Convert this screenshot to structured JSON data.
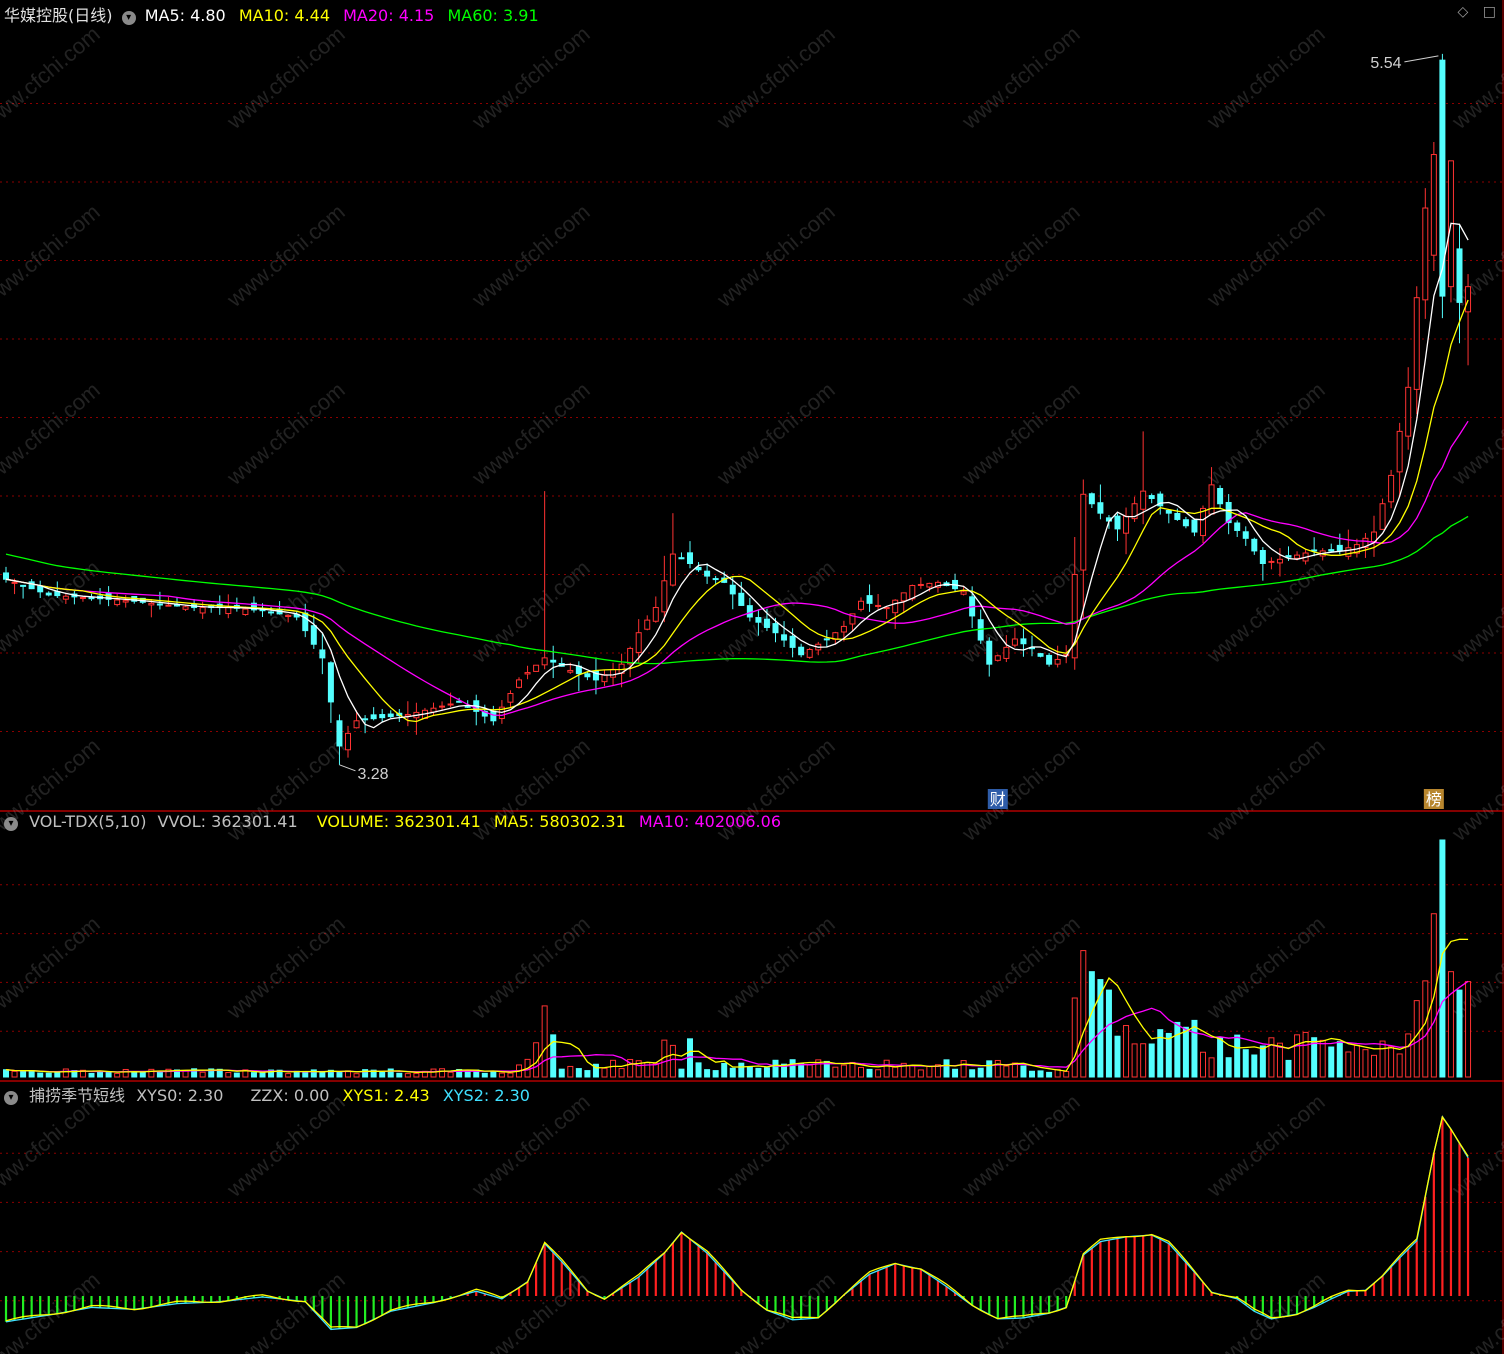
{
  "colors": {
    "up": "#FF3232",
    "down": "#54FFFF",
    "ma5": "#FFFFFF",
    "ma10": "#FFFF00",
    "ma20": "#FF00FF",
    "ma60": "#00FF00",
    "grid": "#8B0000",
    "divider": "#B00000",
    "text": "#C0C0C0",
    "xys_pos": "#FF2020",
    "xys_neg": "#22EE22"
  },
  "main_panel": {
    "title": "华媒控股(日线)",
    "ma_labels": [
      {
        "label": "MA5: 4.80",
        "color": "#FFFFFF"
      },
      {
        "label": "MA10: 4.44",
        "color": "#FFFF00"
      },
      {
        "label": "MA20: 4.15",
        "color": "#FF00FF"
      },
      {
        "label": "MA60: 3.91",
        "color": "#00FF00"
      }
    ],
    "high_label": "5.54",
    "low_label": "3.28",
    "markers": [
      {
        "text": "财",
        "index": 116,
        "bg": "#2E5CA8"
      },
      {
        "text": "榜",
        "index": 167,
        "bg": "#B8862E"
      }
    ]
  },
  "volume_panel": {
    "labels": [
      {
        "label": "VOL-TDX(5,10)",
        "color": "#C0C0C0"
      },
      {
        "label": "VVOL: 362301.41",
        "color": "#C0C0C0"
      },
      {
        "label": "VOLUME: 362301.41",
        "color": "#FFFF00"
      },
      {
        "label": "MA5: 580302.31",
        "color": "#FFFF00"
      },
      {
        "label": "MA10: 402006.06",
        "color": "#FF00FF"
      }
    ]
  },
  "indicator_panel": {
    "labels": [
      {
        "label": "捕捞季节短线",
        "color": "#C0C0C0"
      },
      {
        "label": "XYS0: 2.30",
        "color": "#C0C0C0"
      },
      {
        "label": "ZZX: 0.00",
        "color": "#C0C0C0"
      },
      {
        "label": "XYS1: 2.43",
        "color": "#FFFF00"
      },
      {
        "label": "XYS2: 2.30",
        "color": "#40E0FF"
      }
    ]
  },
  "watermark": "www.cfchi.com",
  "chart_data": {
    "type": "candlestick",
    "title": "华媒控股(日线)",
    "price_range": [
      3.2,
      5.6
    ],
    "days": 172,
    "anchors": [
      [
        0,
        3.87
      ],
      [
        5,
        3.82
      ],
      [
        10,
        3.81
      ],
      [
        15,
        3.8
      ],
      [
        18,
        3.79
      ],
      [
        22,
        3.78
      ],
      [
        26,
        3.78
      ],
      [
        30,
        3.77
      ],
      [
        34,
        3.75
      ],
      [
        37,
        3.62
      ],
      [
        39,
        3.34
      ],
      [
        41,
        3.42
      ],
      [
        44,
        3.43
      ],
      [
        47,
        3.44
      ],
      [
        50,
        3.46
      ],
      [
        53,
        3.48
      ],
      [
        55,
        3.45
      ],
      [
        57,
        3.42
      ],
      [
        60,
        3.55
      ],
      [
        63,
        3.62
      ],
      [
        66,
        3.58
      ],
      [
        69,
        3.55
      ],
      [
        72,
        3.6
      ],
      [
        74,
        3.7
      ],
      [
        76,
        3.78
      ],
      [
        78,
        3.95
      ],
      [
        80,
        3.92
      ],
      [
        82,
        3.88
      ],
      [
        84,
        3.86
      ],
      [
        87,
        3.75
      ],
      [
        90,
        3.7
      ],
      [
        93,
        3.63
      ],
      [
        96,
        3.68
      ],
      [
        98,
        3.72
      ],
      [
        100,
        3.8
      ],
      [
        103,
        3.78
      ],
      [
        106,
        3.85
      ],
      [
        109,
        3.86
      ],
      [
        112,
        3.83
      ],
      [
        115,
        3.6
      ],
      [
        118,
        3.68
      ],
      [
        120,
        3.65
      ],
      [
        122,
        3.6
      ],
      [
        124,
        3.63
      ],
      [
        126,
        4.14
      ],
      [
        128,
        4.08
      ],
      [
        130,
        4.03
      ],
      [
        133,
        4.15
      ],
      [
        136,
        4.08
      ],
      [
        139,
        4.02
      ],
      [
        141,
        4.17
      ],
      [
        143,
        4.05
      ],
      [
        145,
        4.0
      ],
      [
        147,
        3.92
      ],
      [
        150,
        3.94
      ],
      [
        153,
        3.96
      ],
      [
        156,
        3.96
      ],
      [
        158,
        3.98
      ],
      [
        160,
        4.02
      ],
      [
        162,
        4.2
      ],
      [
        164,
        4.48
      ],
      [
        166,
        5.05
      ],
      [
        168,
        5.54
      ],
      [
        169,
        5.3
      ],
      [
        170,
        4.9
      ],
      [
        171,
        4.8
      ]
    ],
    "volume_range": [
      0,
      900000
    ],
    "volume_spikes": [
      [
        62,
        130000
      ],
      [
        63,
        270000
      ],
      [
        64,
        160000
      ],
      [
        77,
        140000
      ],
      [
        78,
        120000
      ],
      [
        80,
        145000
      ],
      [
        125,
        300000
      ],
      [
        126,
        480000
      ],
      [
        127,
        400000
      ],
      [
        128,
        370000
      ],
      [
        129,
        330000
      ],
      [
        165,
        290000
      ],
      [
        166,
        365000
      ],
      [
        167,
        620000
      ],
      [
        168,
        900000
      ],
      [
        169,
        400000
      ],
      [
        170,
        330000
      ],
      [
        171,
        362301.41
      ]
    ],
    "ma_last": {
      "MA5": 4.8,
      "MA10": 4.44,
      "MA20": 4.15,
      "MA60": 3.91
    },
    "volume_last": {
      "VOLUME": 362301.41,
      "MA5": 580302.31,
      "MA10": 402006.06
    },
    "indicator_last": {
      "XYS0": 2.3,
      "ZZX": 0.0,
      "XYS1": 2.43,
      "XYS2": 2.3
    },
    "indicator_range": [
      -0.35,
      1.95
    ],
    "indicator_wave": [
      [
        0,
        -0.27
      ],
      [
        5,
        -0.2
      ],
      [
        10,
        -0.12
      ],
      [
        15,
        -0.14
      ],
      [
        20,
        -0.08
      ],
      [
        25,
        -0.06
      ],
      [
        30,
        -0.01
      ],
      [
        35,
        -0.06
      ],
      [
        38,
        -0.35
      ],
      [
        41,
        -0.33
      ],
      [
        45,
        -0.16
      ],
      [
        50,
        -0.07
      ],
      [
        55,
        0.05
      ],
      [
        58,
        -0.03
      ],
      [
        61,
        0.15
      ],
      [
        63,
        0.55
      ],
      [
        65,
        0.36
      ],
      [
        68,
        0.05
      ],
      [
        70,
        -0.03
      ],
      [
        74,
        0.2
      ],
      [
        77,
        0.45
      ],
      [
        79,
        0.67
      ],
      [
        82,
        0.45
      ],
      [
        86,
        0.06
      ],
      [
        89,
        -0.15
      ],
      [
        92,
        -0.25
      ],
      [
        95,
        -0.23
      ],
      [
        98,
        0.01
      ],
      [
        101,
        0.23
      ],
      [
        104,
        0.34
      ],
      [
        107,
        0.28
      ],
      [
        110,
        0.1
      ],
      [
        113,
        -0.1
      ],
      [
        116,
        -0.24
      ],
      [
        119,
        -0.23
      ],
      [
        122,
        -0.18
      ],
      [
        124,
        -0.12
      ],
      [
        126,
        0.43
      ],
      [
        128,
        0.57
      ],
      [
        131,
        0.62
      ],
      [
        134,
        0.64
      ],
      [
        136,
        0.55
      ],
      [
        139,
        0.25
      ],
      [
        141,
        0.04
      ],
      [
        144,
        -0.03
      ],
      [
        146,
        -0.16
      ],
      [
        148,
        -0.24
      ],
      [
        151,
        -0.19
      ],
      [
        153,
        -0.12
      ],
      [
        155,
        -0.03
      ],
      [
        157,
        0.05
      ],
      [
        159,
        0.06
      ],
      [
        161,
        0.21
      ],
      [
        163,
        0.4
      ],
      [
        165,
        0.58
      ],
      [
        167,
        1.5
      ],
      [
        168,
        1.88
      ],
      [
        169,
        1.75
      ],
      [
        171,
        1.45
      ]
    ]
  }
}
